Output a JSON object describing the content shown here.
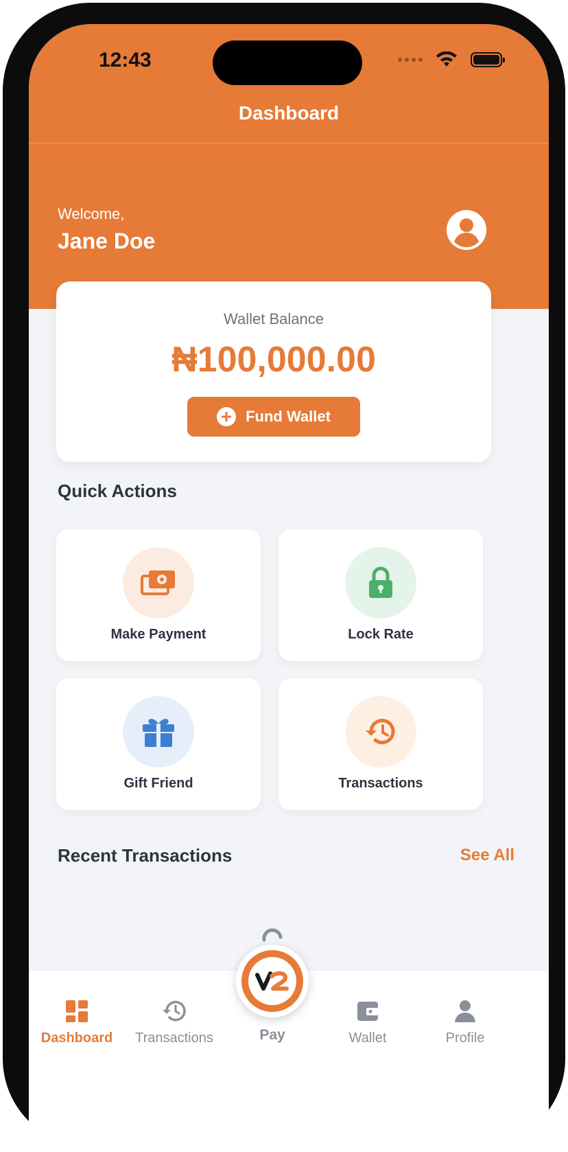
{
  "status_bar": {
    "time": "12:43"
  },
  "header": {
    "title": "Dashboard",
    "welcome": "Welcome,",
    "user_name": "Jane Doe"
  },
  "wallet": {
    "label": "Wallet Balance",
    "balance": "₦100,000.00",
    "fund_button": "Fund Wallet"
  },
  "quick_actions": {
    "title": "Quick Actions",
    "items": [
      {
        "label": "Make Payment",
        "icon": "money-icon",
        "color": "#e67a37"
      },
      {
        "label": "Lock Rate",
        "icon": "lock-icon",
        "color": "#4caf6a"
      },
      {
        "label": "Gift Friend",
        "icon": "gift-icon",
        "color": "#3d7fd1"
      },
      {
        "label": "Transactions",
        "icon": "history-icon",
        "color": "#e67a37"
      }
    ]
  },
  "recent_transactions": {
    "title": "Recent Transactions",
    "see_all": "See All"
  },
  "tabbar": {
    "items": [
      {
        "label": "Dashboard",
        "icon": "dashboard-icon",
        "active": true
      },
      {
        "label": "Transactions",
        "icon": "history-icon",
        "active": false
      },
      {
        "label": "Pay",
        "icon": "pay-logo-icon",
        "active": false
      },
      {
        "label": "Wallet",
        "icon": "wallet-icon",
        "active": false
      },
      {
        "label": "Profile",
        "icon": "profile-icon",
        "active": false
      }
    ]
  },
  "colors": {
    "accent": "#e67a37",
    "background": "#f3f4f7",
    "text": "#2d3340"
  }
}
